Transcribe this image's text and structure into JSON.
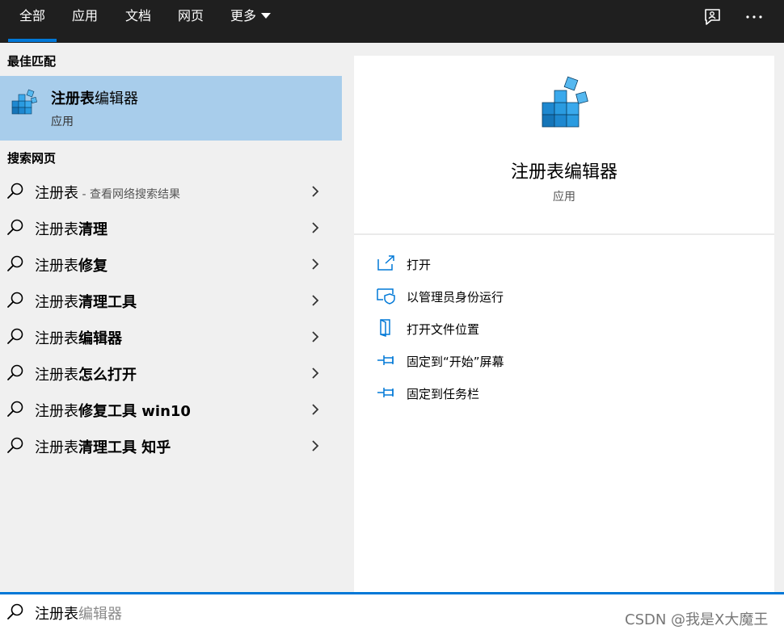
{
  "tabs": [
    {
      "label": "全部",
      "active": true
    },
    {
      "label": "应用"
    },
    {
      "label": "文档"
    },
    {
      "label": "网页"
    },
    {
      "label": "更多"
    }
  ],
  "icons": {
    "feedback": "feedback-icon",
    "more_options": "more-options-icon",
    "search": "search-icon",
    "chevron": "chevron-right-icon",
    "registry": "registry-editor-icon"
  },
  "best_match": {
    "section_title": "最佳匹配",
    "name_bold": "注册表",
    "name_rest": "编辑器",
    "type": "应用"
  },
  "web_search": {
    "section_title": "搜索网页",
    "items": [
      {
        "prefix": "注册表",
        "bold": "",
        "hint": " - 查看网络搜索结果"
      },
      {
        "prefix": "注册表",
        "bold": "清理",
        "hint": ""
      },
      {
        "prefix": "注册表",
        "bold": "修复",
        "hint": ""
      },
      {
        "prefix": "注册表",
        "bold": "清理工具",
        "hint": ""
      },
      {
        "prefix": "注册表",
        "bold": "编辑器",
        "hint": ""
      },
      {
        "prefix": "注册表",
        "bold": "怎么打开",
        "hint": ""
      },
      {
        "prefix": "注册表",
        "bold": "修复工具 win10",
        "hint": ""
      },
      {
        "prefix": "注册表",
        "bold": "清理工具 知乎",
        "hint": ""
      }
    ]
  },
  "detail": {
    "title": "注册表编辑器",
    "subtitle": "应用",
    "actions": [
      {
        "label": "打开",
        "icon": "open-icon"
      },
      {
        "label": "以管理员身份运行",
        "icon": "run-as-admin-icon"
      },
      {
        "label": "打开文件位置",
        "icon": "file-location-icon"
      },
      {
        "label": "固定到“开始”屏幕",
        "icon": "pin-start-icon"
      },
      {
        "label": "固定到任务栏",
        "icon": "pin-taskbar-icon"
      }
    ]
  },
  "search": {
    "typed": "注册表",
    "suggested": "编辑器"
  },
  "watermark": "CSDN @我是X大魔王",
  "colors": {
    "accent": "#0078d7",
    "topbar": "#1f1f1f",
    "selected": "#a8cdeb"
  }
}
